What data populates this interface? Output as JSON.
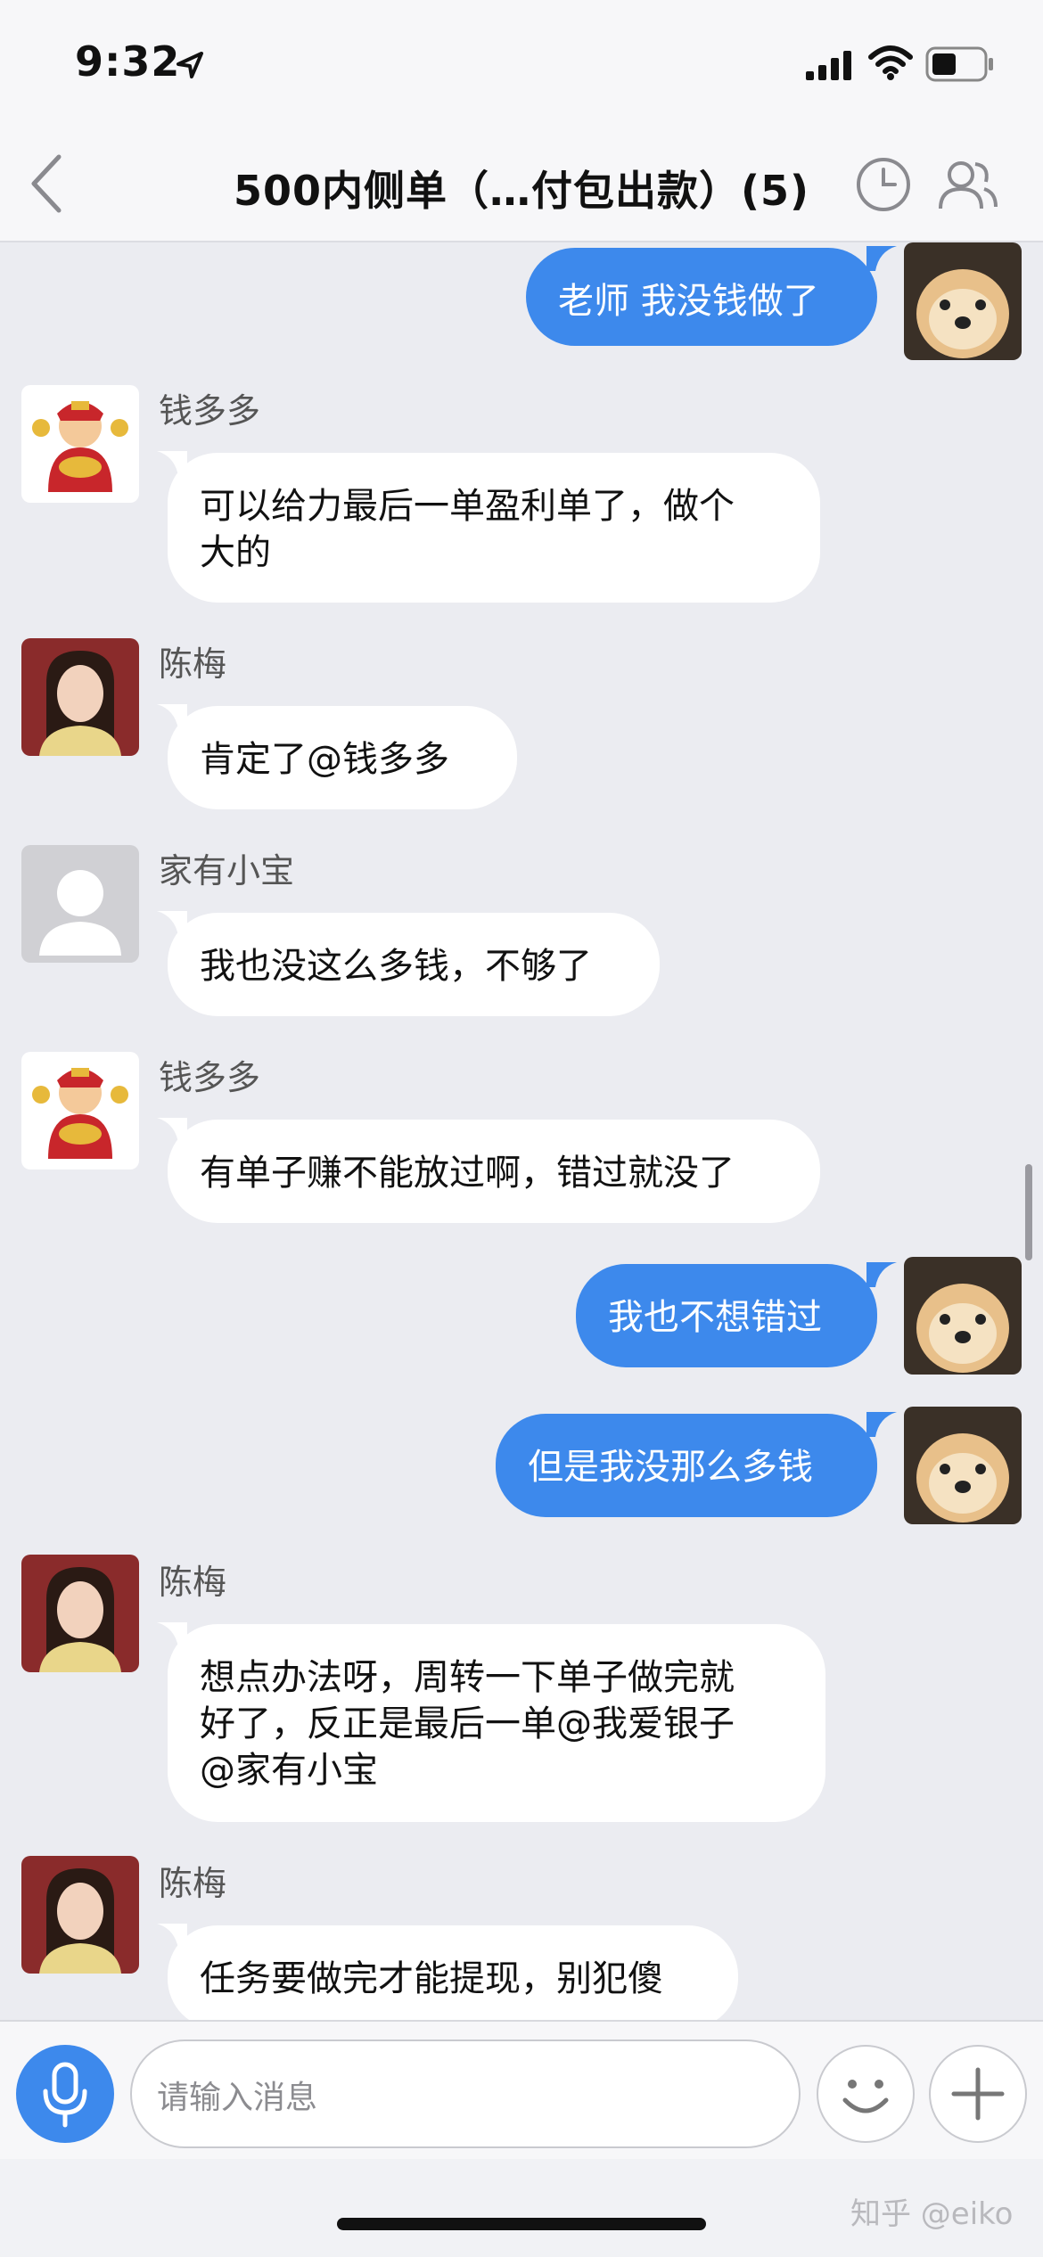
{
  "status_bar": {
    "time": "9:32"
  },
  "header": {
    "title": "500内侧单（…付包出款）(5)"
  },
  "messages": [
    {
      "sender": "",
      "text": "老师 我没钱做了"
    },
    {
      "sender": "钱多多",
      "line1": "可以给力最后一单盈利单了，做个",
      "line2": "大的"
    },
    {
      "sender": "陈梅",
      "text": "肯定了@钱多多"
    },
    {
      "sender": "家有小宝",
      "text": "我也没这么多钱，不够了"
    },
    {
      "sender": "钱多多",
      "text": "有单子赚不能放过啊，错过就没了"
    },
    {
      "sender": "",
      "text": "我也不想错过"
    },
    {
      "sender": "",
      "text": "但是我没那么多钱"
    },
    {
      "sender": "陈梅",
      "line1": "想点办法呀，周转一下单子做完就",
      "line2": "好了，反正是最后一单@我爱银子",
      "line3": "@家有小宝"
    },
    {
      "sender": "陈梅",
      "text": "任务要做完才能提现，别犯傻"
    }
  ],
  "input": {
    "placeholder": "请输入消息"
  },
  "watermark": "知乎 @eiko",
  "colors": {
    "accent": "#3d89ec",
    "background": "#ebecf1"
  },
  "icons": [
    "location-arrow-icon",
    "signal-icon",
    "wifi-icon",
    "battery-icon",
    "back-chevron-icon",
    "clock-icon",
    "group-members-icon",
    "microphone-icon",
    "smiley-icon",
    "plus-icon"
  ]
}
